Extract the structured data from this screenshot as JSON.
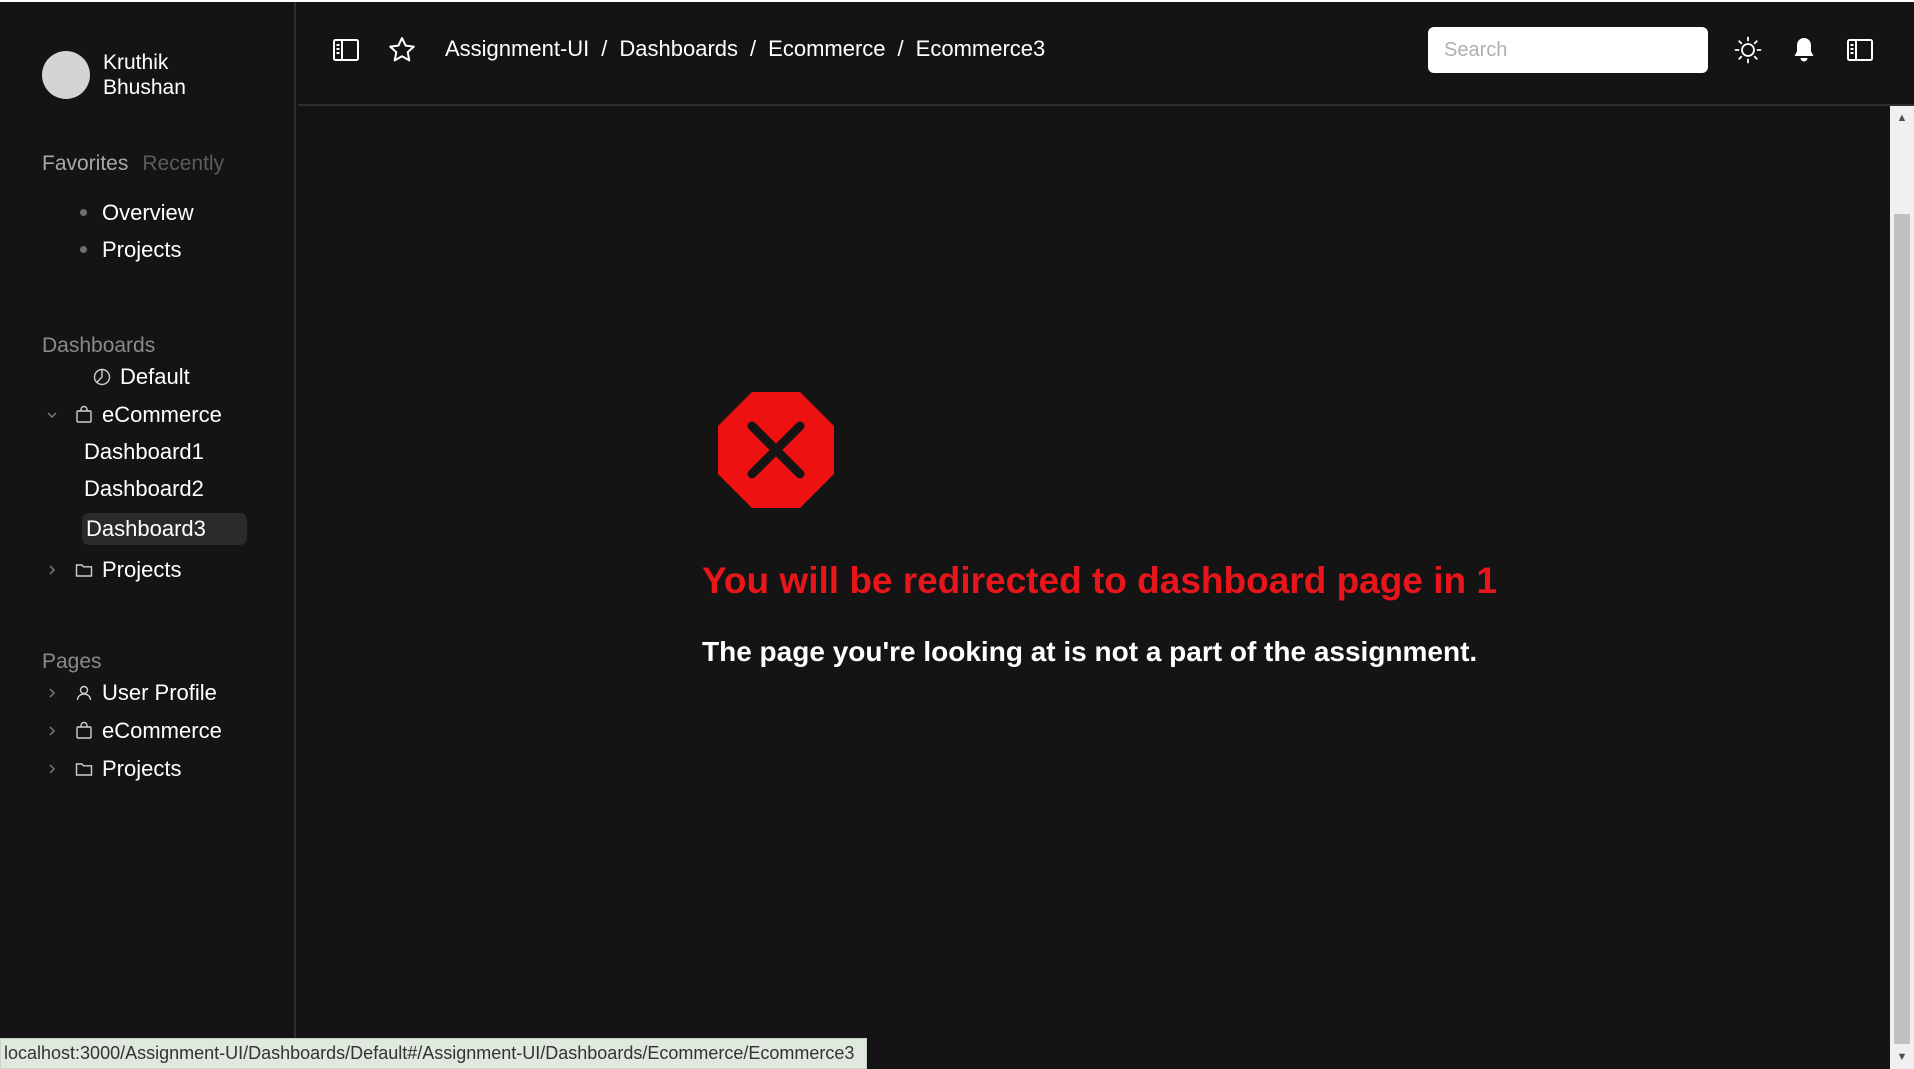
{
  "user": {
    "name": "Kruthik Bhushan",
    "avatar_text": ""
  },
  "sidebar": {
    "tabs": [
      {
        "label": "Favorites",
        "active": true
      },
      {
        "label": "Recently",
        "active": false
      }
    ],
    "favorites": [
      {
        "label": "Overview"
      },
      {
        "label": "Projects"
      }
    ],
    "dashboards_label": "Dashboards",
    "dashboards": {
      "default": {
        "label": "Default",
        "icon": "pie-chart-icon"
      },
      "ecommerce": {
        "label": "eCommerce",
        "icon": "shopping-bag-icon",
        "expanded": true,
        "children": [
          {
            "label": "Dashboard1",
            "active": false
          },
          {
            "label": "Dashboard2",
            "active": false
          },
          {
            "label": "Dashboard3",
            "active": true
          }
        ]
      },
      "projects": {
        "label": "Projects",
        "icon": "folder-icon"
      }
    },
    "pages_label": "Pages",
    "pages": [
      {
        "label": "User Profile",
        "icon": "user-icon"
      },
      {
        "label": "eCommerce",
        "icon": "shopping-bag-icon"
      },
      {
        "label": "Projects",
        "icon": "folder-icon"
      }
    ]
  },
  "header": {
    "breadcrumb": [
      "Assignment-UI",
      "Dashboards",
      "Ecommerce",
      "Ecommerce3"
    ],
    "separator": "/",
    "search_placeholder": "Search",
    "icons": [
      "sidebar-toggle-icon",
      "star-icon",
      "sun-icon",
      "bell-icon",
      "panel-toggle-icon"
    ]
  },
  "main": {
    "redirect_message": "You will be redirected to dashboard page in 1",
    "info_message": "The page you're looking at is not a part of the assignment.",
    "error_color": "#e8151b"
  },
  "status_bar": {
    "url": "localhost:3000/Assignment-UI/Dashboards/Default#/Assignment-UI/Dashboards/Ecommerce/Ecommerce3"
  }
}
